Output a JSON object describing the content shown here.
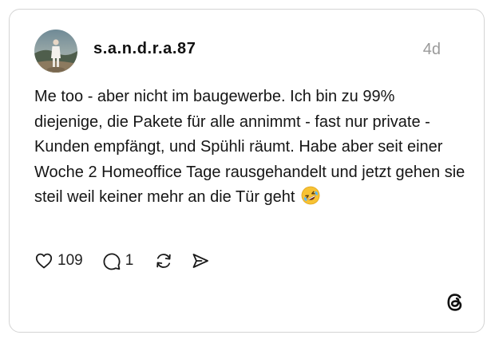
{
  "post": {
    "username": "s.a.n.d.r.a.87",
    "timestamp": "4d",
    "text": "Me too - aber nicht im baugewerbe. Ich bin zu 99% diejenige, die Pakete für alle annimmt - fast nur private - Kunden empfängt, und Spühli räumt. Habe aber seit einer Woche 2 Homeoffice Tage rausgehandelt und jetzt gehen sie steil weil keiner mehr an die Tür geht",
    "emoji": "🤣",
    "avatar_icon": "profile-photo"
  },
  "actions": {
    "like": {
      "icon": "heart-icon",
      "count": "109"
    },
    "reply": {
      "icon": "comment-bubble-icon",
      "count": "1"
    },
    "repost": {
      "icon": "repost-icon"
    },
    "share": {
      "icon": "send-icon"
    }
  },
  "brand": {
    "icon": "threads-logo-icon"
  },
  "colors": {
    "border": "#d4d4d4",
    "text": "#111111",
    "muted": "#9a9a9a"
  }
}
